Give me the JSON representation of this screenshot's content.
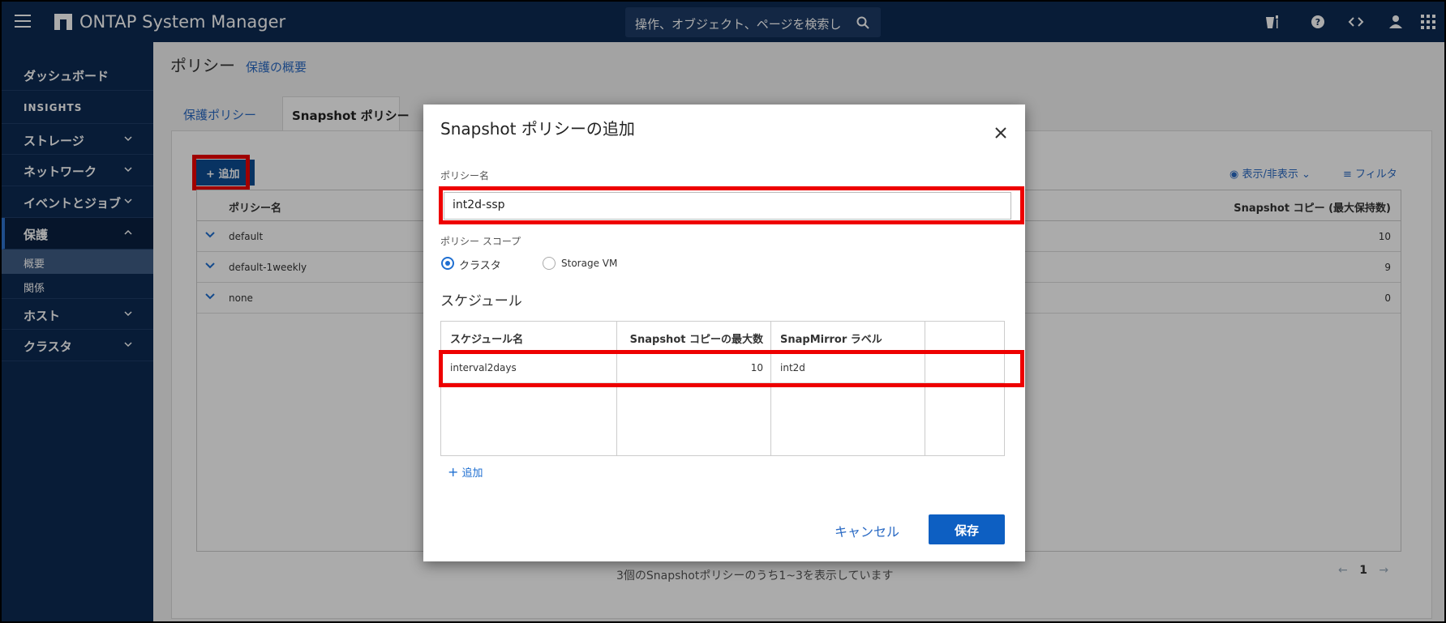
{
  "header": {
    "app_title": "ONTAP System Manager",
    "search_placeholder": "操作、オブジェクト、ページを検索し"
  },
  "sidebar": {
    "dashboard": "ダッシュボード",
    "insights": "INSIGHTS",
    "storage": "ストレージ",
    "network": "ネットワーク",
    "events_jobs": "イベントとジョブ",
    "protection": "保護",
    "overview": "概要",
    "relationships": "関係",
    "hosts": "ホスト",
    "cluster": "クラスタ"
  },
  "page": {
    "title": "ポリシー",
    "overview_link": "保護の概要",
    "tabs": [
      "保護ポリシー",
      "Snapshot ポリシー"
    ],
    "add_button": "追加",
    "view_toggle": "表示/非表示",
    "filter": "フィルタ",
    "columns": {
      "name": "ポリシー名",
      "copies": "Snapshot コピー (最大保持数)"
    },
    "rows": [
      {
        "name": "default",
        "copies": "10"
      },
      {
        "name": "default-1weekly",
        "copies": "9"
      },
      {
        "name": "none",
        "copies": "0"
      }
    ],
    "footer": "3個のSnapshotポリシーのうち1~3を表示しています",
    "page_number": "1"
  },
  "modal": {
    "title": "Snapshot ポリシーの追加",
    "name_label": "ポリシー名",
    "name_value": "int2d-ssp",
    "scope_label": "ポリシー スコープ",
    "scope_cluster": "クラスタ",
    "scope_svm": "Storage VM",
    "scope_selected": "クラスタ",
    "schedule_title": "スケジュール",
    "schedule_columns": {
      "name": "スケジュール名",
      "max": "Snapshot コピーの最大数",
      "label": "SnapMirror ラベル"
    },
    "schedule_rows": [
      {
        "name": "interval2days",
        "max": "10",
        "label": "int2d"
      }
    ],
    "add_schedule": "追加",
    "cancel": "キャンセル",
    "save": "保存"
  },
  "colors": {
    "nav": "#0d2a52",
    "primary": "#0d5fc2",
    "highlight": "#e00000"
  }
}
